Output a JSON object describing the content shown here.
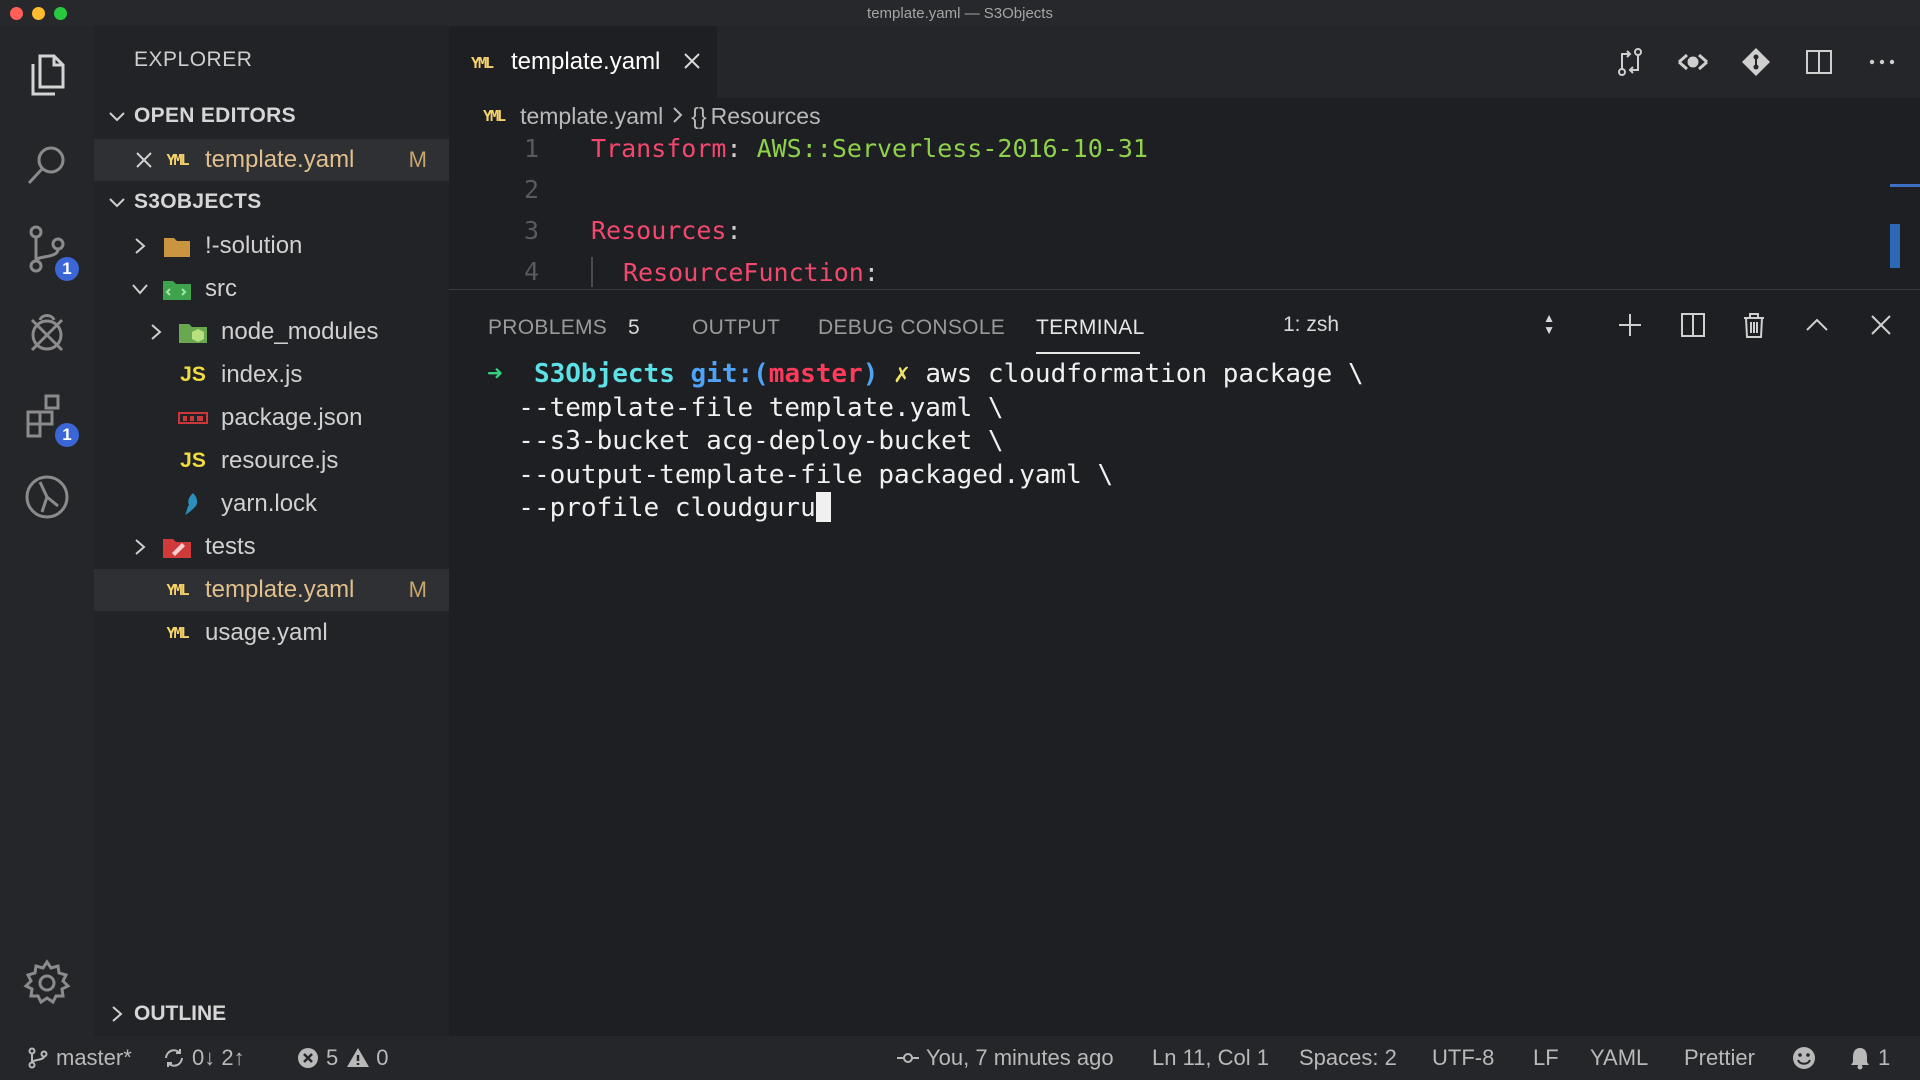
{
  "window": {
    "title": "template.yaml — S3Objects"
  },
  "activity": {
    "scm_badge": "1",
    "extensions_badge": "1"
  },
  "sidebar": {
    "title": "EXPLORER",
    "open_editors_label": "OPEN EDITORS",
    "open_editors": [
      {
        "icon": "yaml-icon",
        "name": "template.yaml",
        "status": "M"
      }
    ],
    "project_label": "S3OBJECTS",
    "tree": [
      {
        "name": "!-solution",
        "type": "folder",
        "expanded": false
      },
      {
        "name": "src",
        "type": "folder",
        "expanded": true
      },
      {
        "name": "node_modules",
        "type": "folder",
        "expanded": false
      },
      {
        "name": "index.js",
        "icon_text": "JS"
      },
      {
        "name": "package.json"
      },
      {
        "name": "resource.js",
        "icon_text": "JS"
      },
      {
        "name": "yarn.lock"
      },
      {
        "name": "tests",
        "type": "folder",
        "expanded": false
      },
      {
        "name": "template.yaml",
        "status": "M"
      },
      {
        "name": "usage.yaml"
      }
    ],
    "outline_label": "OUTLINE"
  },
  "yaml_icon_text": "YML",
  "editor": {
    "tab_label": "template.yaml",
    "breadcrumb": {
      "file": "template.yaml",
      "symbol_icon": "{}",
      "symbol": "Resources"
    },
    "lines": [
      {
        "num": "1",
        "key": "Transform",
        "colon": ":",
        "value": " AWS::Serverless-2016-10-31"
      },
      {
        "num": "2",
        "key": "",
        "colon": "",
        "value": ""
      },
      {
        "num": "3",
        "key": "Resources",
        "colon": ":",
        "value": ""
      },
      {
        "num": "4",
        "key": "ResourceFunction",
        "colon": ":",
        "value": ""
      }
    ]
  },
  "panel": {
    "tabs": {
      "problems": "PROBLEMS",
      "problems_count": "5",
      "output": "OUTPUT",
      "debug_console": "DEBUG CONSOLE",
      "terminal": "TERMINAL"
    },
    "shell": "1: zsh",
    "terminal": {
      "arrow": "➜",
      "dir": "S3Objects",
      "git_prefix": "git:(",
      "branch": "master",
      "git_suffix": ")",
      "dirty_mark": "✗",
      "lines": [
        "aws cloudformation package \\",
        "  --template-file template.yaml \\",
        "  --s3-bucket acg-deploy-bucket \\",
        "  --output-template-file packaged.yaml \\",
        "  --profile cloudguru"
      ]
    }
  },
  "statusbar": {
    "branch": "master*",
    "sync": "0↓ 2↑",
    "errors": "5",
    "warnings": "0",
    "blame": "You, 7 minutes ago",
    "position": "Ln 11, Col 1",
    "spaces": "Spaces: 2",
    "encoding": "UTF-8",
    "eol": "LF",
    "language": "YAML",
    "formatter": "Prettier",
    "notifications": "1"
  },
  "colors": {
    "accent_blue": "#3a66d6",
    "yaml_key": "#f2486e",
    "yaml_value": "#8fd14b",
    "modified": "#c9a66b"
  }
}
